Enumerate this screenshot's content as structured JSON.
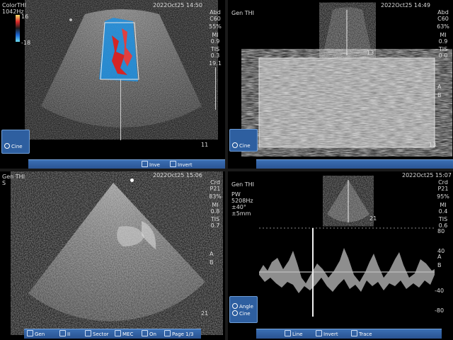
{
  "panels": {
    "top_left": {
      "mode": [
        "ColorTHI",
        "1042Hz"
      ],
      "color_scale": {
        "top": "16",
        "bottom": "-18"
      },
      "date": "2022Oct25",
      "time": "14:50",
      "params": [
        [
          "Abd",
          "C60"
        ],
        [
          "",
          "55%"
        ],
        [
          "MI",
          "0.9"
        ],
        [
          "TIS",
          "0.3"
        ],
        [
          "",
          "19.1"
        ]
      ],
      "depth_label": "11",
      "sidebar": [
        "Cine"
      ],
      "toolbar": [
        "Inve",
        "Invert"
      ]
    },
    "top_right": {
      "mode": [
        "Gen",
        "THI"
      ],
      "date": "2022Oct25",
      "time": "14:49",
      "params": [
        [
          "Abd",
          "C60"
        ],
        [
          "",
          "63%"
        ],
        [
          "MI",
          "0.9"
        ],
        [
          "TIS",
          "0.0"
        ]
      ],
      "depth_label": "13",
      "sidebar": [
        "Cine"
      ],
      "labels": {
        "a": "A",
        "b": "B"
      }
    },
    "bottom_left": {
      "mode": [
        "Gen",
        "THI"
      ],
      "sub": "S",
      "date": "2022Oct25",
      "time": "15:06",
      "params": [
        [
          "Crd",
          "P21"
        ],
        [
          "",
          "83%"
        ],
        [
          "MI",
          "0.8"
        ],
        [
          "TIS",
          "0.7"
        ]
      ],
      "depth_label": "21",
      "labels": {
        "a": "A",
        "b": "B"
      },
      "toolbar": [
        "Gen",
        "II",
        "Sector",
        "MEC",
        "On",
        "Page 1/3"
      ]
    },
    "bottom_right": {
      "mode": [
        "Gen",
        "THI"
      ],
      "pw": [
        "PW",
        "5208Hz",
        "±40°",
        "±5mm"
      ],
      "date": "2022Oct25",
      "time": "15:07",
      "params": [
        [
          "Crd",
          "P21"
        ],
        [
          "",
          "95%"
        ],
        [
          "MI",
          "0.4"
        ],
        [
          "TIS",
          "0.6"
        ]
      ],
      "depth_label": "21",
      "velocity_scale": [
        "80",
        "40",
        "-40",
        "-80"
      ],
      "sidebar": [
        "Angle",
        "Cine"
      ],
      "toolbar": [
        "Line",
        "Invert",
        "Trace"
      ],
      "labels": {
        "a": "A",
        "b": "B"
      }
    }
  },
  "colors": {
    "ui_blue": "#2e5fa0",
    "flow_red": "#d23030",
    "flow_blue": "#2a8fd8"
  }
}
